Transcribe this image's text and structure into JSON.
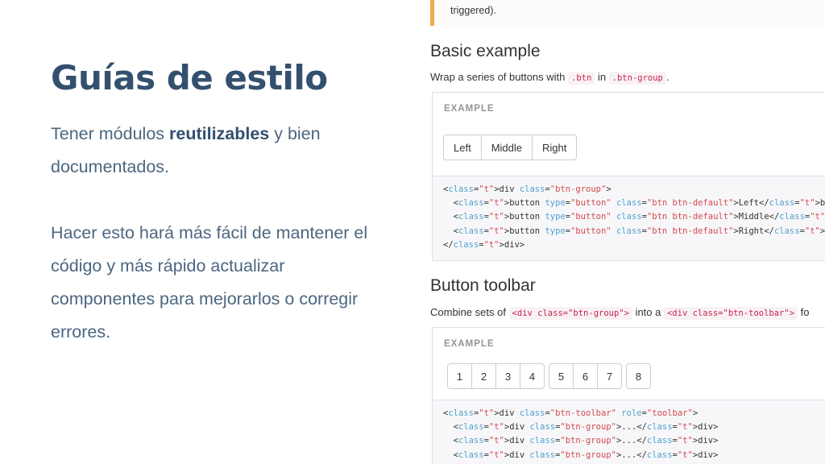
{
  "slide": {
    "title": "Guías de estilo",
    "p1_before": "Tener módulos ",
    "p1_strong": "reutilizables",
    "p1_after": " y bien documentados.",
    "p2": "Hacer esto hará más fácil de mantener el código y más rápido actualizar componentes para mejorarlos o corregir errores."
  },
  "doc": {
    "callout_text": "triggered).",
    "basic": {
      "heading": "Basic example",
      "lead_before": "Wrap a series of buttons with ",
      "code1": ".btn",
      "lead_mid": " in ",
      "code2": ".btn-group",
      "lead_after": ".",
      "example_label": "EXAMPLE",
      "buttons": [
        "Left",
        "Middle",
        "Right"
      ],
      "code_lines": [
        "<div class=\"btn-group\">",
        "  <button type=\"button\" class=\"btn btn-default\">Left</button>",
        "  <button type=\"button\" class=\"btn btn-default\">Middle</button>",
        "  <button type=\"button\" class=\"btn btn-default\">Right</button>",
        "</div>"
      ]
    },
    "toolbar": {
      "heading": "Button toolbar",
      "lead_before": "Combine sets of ",
      "code1": "<div class=\"btn-group\">",
      "lead_mid": " into a ",
      "code2": "<div class=\"btn-toolbar\">",
      "lead_after": " fo",
      "example_label": "EXAMPLE",
      "groups": [
        [
          "1",
          "2",
          "3",
          "4"
        ],
        [
          "5",
          "6",
          "7"
        ],
        [
          "8"
        ]
      ],
      "code_lines": [
        "<div class=\"btn-toolbar\" role=\"toolbar\">",
        "  <div class=\"btn-group\">...</div>",
        "  <div class=\"btn-group\">...</div>",
        "  <div class=\"btn-group\">...</div>"
      ]
    }
  }
}
